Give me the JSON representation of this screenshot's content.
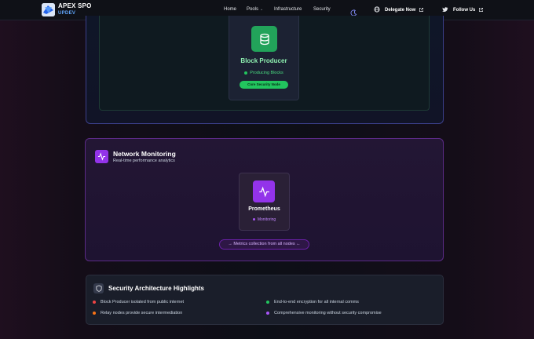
{
  "brand": {
    "title": "APEX SPO",
    "subtitle": "UPDEV"
  },
  "nav": {
    "home": "Home",
    "pools": "Pools",
    "infrastructure": "Infrastructure",
    "security": "Security",
    "delegate": "Delegate Now",
    "follow": "Follow Us"
  },
  "block_producer": {
    "title": "Block Producer",
    "status": "Producing Blocks",
    "badge": "Core Security Node"
  },
  "monitoring": {
    "title": "Network Monitoring",
    "subtitle": "Real-time performance analytics",
    "card_title": "Prometheus",
    "card_status": "Monitoring",
    "pill": "→ Metrics collection from all nodes ←"
  },
  "highlights": {
    "title": "Security Architecture Highlights",
    "items": [
      {
        "text": "Block Producer isolated from public internet",
        "color": "#ef4444"
      },
      {
        "text": "End-to-end encryption for all internal comms",
        "color": "#22c55e"
      },
      {
        "text": "Relay nodes provide secure intermediation",
        "color": "#f97316"
      },
      {
        "text": "Comprehensive monitoring without security compromise",
        "color": "#a855f7"
      }
    ]
  },
  "icons": {
    "logo": "apex-logo-icon",
    "theme": "moon-icon",
    "external": "external-link-icon",
    "twitter": "twitter-icon",
    "globe": "globe-icon",
    "database": "database-icon",
    "activity": "activity-icon",
    "shield": "shield-icon"
  }
}
